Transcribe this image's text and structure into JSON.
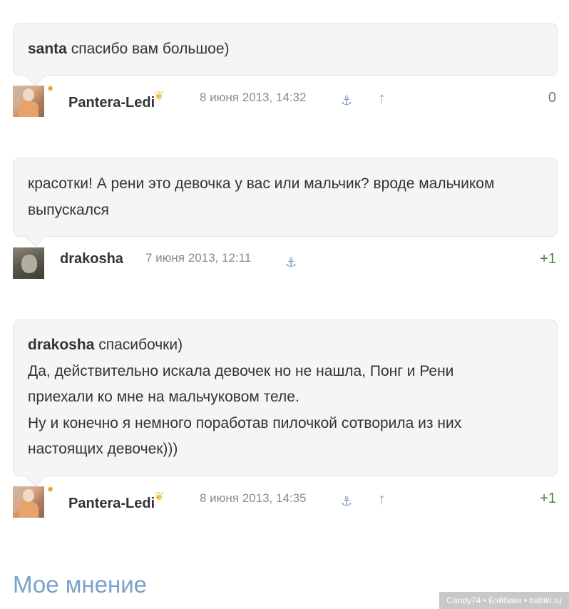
{
  "comments": [
    {
      "addressee": "santa",
      "text_lines": [
        "спасибо вам большое)"
      ],
      "author": "Pantera-Ledi",
      "date": "8 июня 2013, 14:32",
      "rating": "0"
    },
    {
      "addressee": "",
      "text_lines": [
        "красотки! А рени это девочка у вас или мальчик? вроде мальчиком",
        "выпускался"
      ],
      "author": "drakosha",
      "date": "7 июня 2013, 12:11",
      "rating": "+1"
    },
    {
      "addressee": "drakosha",
      "text_lines": [
        "спасибочки)",
        "Да, действительно искала девочек но не нашла, Понг и Рени",
        "приехали ко мне на мальчуковом теле.",
        "Ну и конечно я немного поработав пилочкой сотворила из них",
        "настоящих девочек)))"
      ],
      "author": "Pantera-Ledi",
      "date": "8 июня 2013, 14:35",
      "rating": "+1"
    }
  ],
  "footer": {
    "my_opinion": "Мое мнение",
    "watermark": "Candy74 • Бэйбики • babiki.ru"
  },
  "icons": {
    "anchor": "anchor-icon",
    "reply_up": "arrow-up-icon",
    "badge": "butterfly-icon",
    "rank": "star-rank-icon"
  },
  "colors": {
    "bubble_bg": "#f5f5f5",
    "positive_rating": "#3e8a2e",
    "link": "#7aa3c8",
    "meta_gray": "#8a8a8a"
  }
}
